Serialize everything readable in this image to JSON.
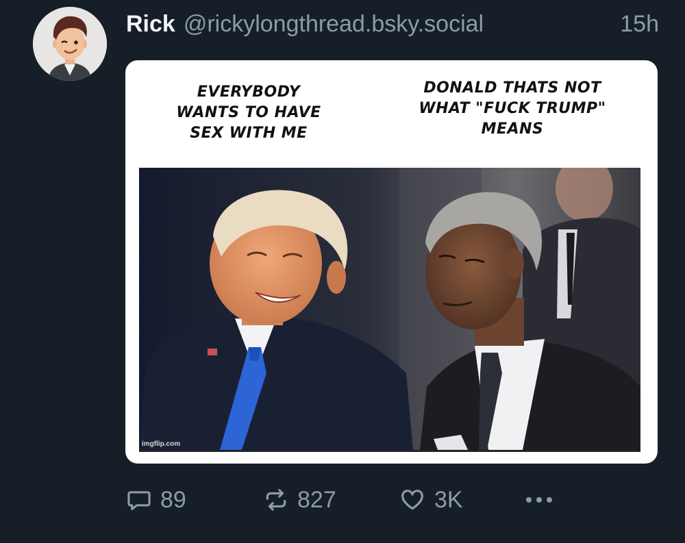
{
  "post": {
    "author_name": "Rick",
    "author_handle": "@rickylongthread.bsky.social",
    "timestamp": "15h"
  },
  "media": {
    "caption_left": "EVERYBODY WANTS TO HAVE SEX WITH ME",
    "caption_right": "DONALD THATS NOT WHAT \"FUCK TRUMP\" MEANS",
    "watermark": "imgflip.com"
  },
  "actions": {
    "reply_count": "89",
    "repost_count": "827",
    "like_count": "3K",
    "more_label": "•••"
  },
  "colors": {
    "background": "#161e27",
    "text_primary": "#f2f4f7",
    "text_secondary": "#8c9bab"
  },
  "icons": [
    "reply-icon",
    "repost-icon",
    "like-icon",
    "more-icon"
  ]
}
